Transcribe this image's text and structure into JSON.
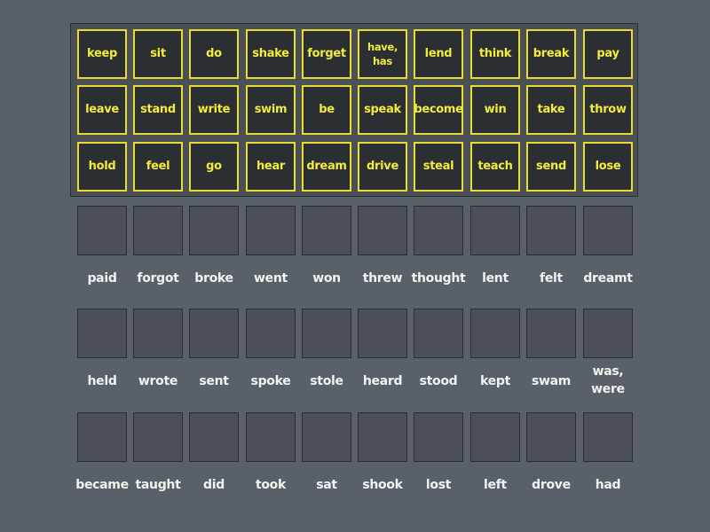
{
  "tiles": [
    [
      "keep",
      "sit",
      "do",
      "shake",
      "forget",
      "have, has",
      "lend",
      "think",
      "break",
      "pay"
    ],
    [
      "leave",
      "stand",
      "write",
      "swim",
      "be",
      "speak",
      "become",
      "win",
      "take",
      "throw"
    ],
    [
      "hold",
      "feel",
      "go",
      "hear",
      "dream",
      "drive",
      "steal",
      "teach",
      "send",
      "lose"
    ]
  ],
  "targets": [
    [
      "paid",
      "forgot",
      "broke",
      "went",
      "won",
      "threw",
      "thought",
      "lent",
      "felt",
      "dreamt"
    ],
    [
      "held",
      "wrote",
      "sent",
      "spoke",
      "stole",
      "heard",
      "stood",
      "kept",
      "swam",
      "was, were"
    ],
    [
      "became",
      "taught",
      "did",
      "took",
      "sat",
      "shook",
      "lost",
      "left",
      "drove",
      "had"
    ]
  ],
  "colors": {
    "background": "#5a6067",
    "tile_border": "#e8dc2c",
    "tile_text": "#f4ec3a",
    "tile_fill": "#2b2f33",
    "slot_fill": "#4b5057",
    "label_text": "#f2f2f2"
  }
}
